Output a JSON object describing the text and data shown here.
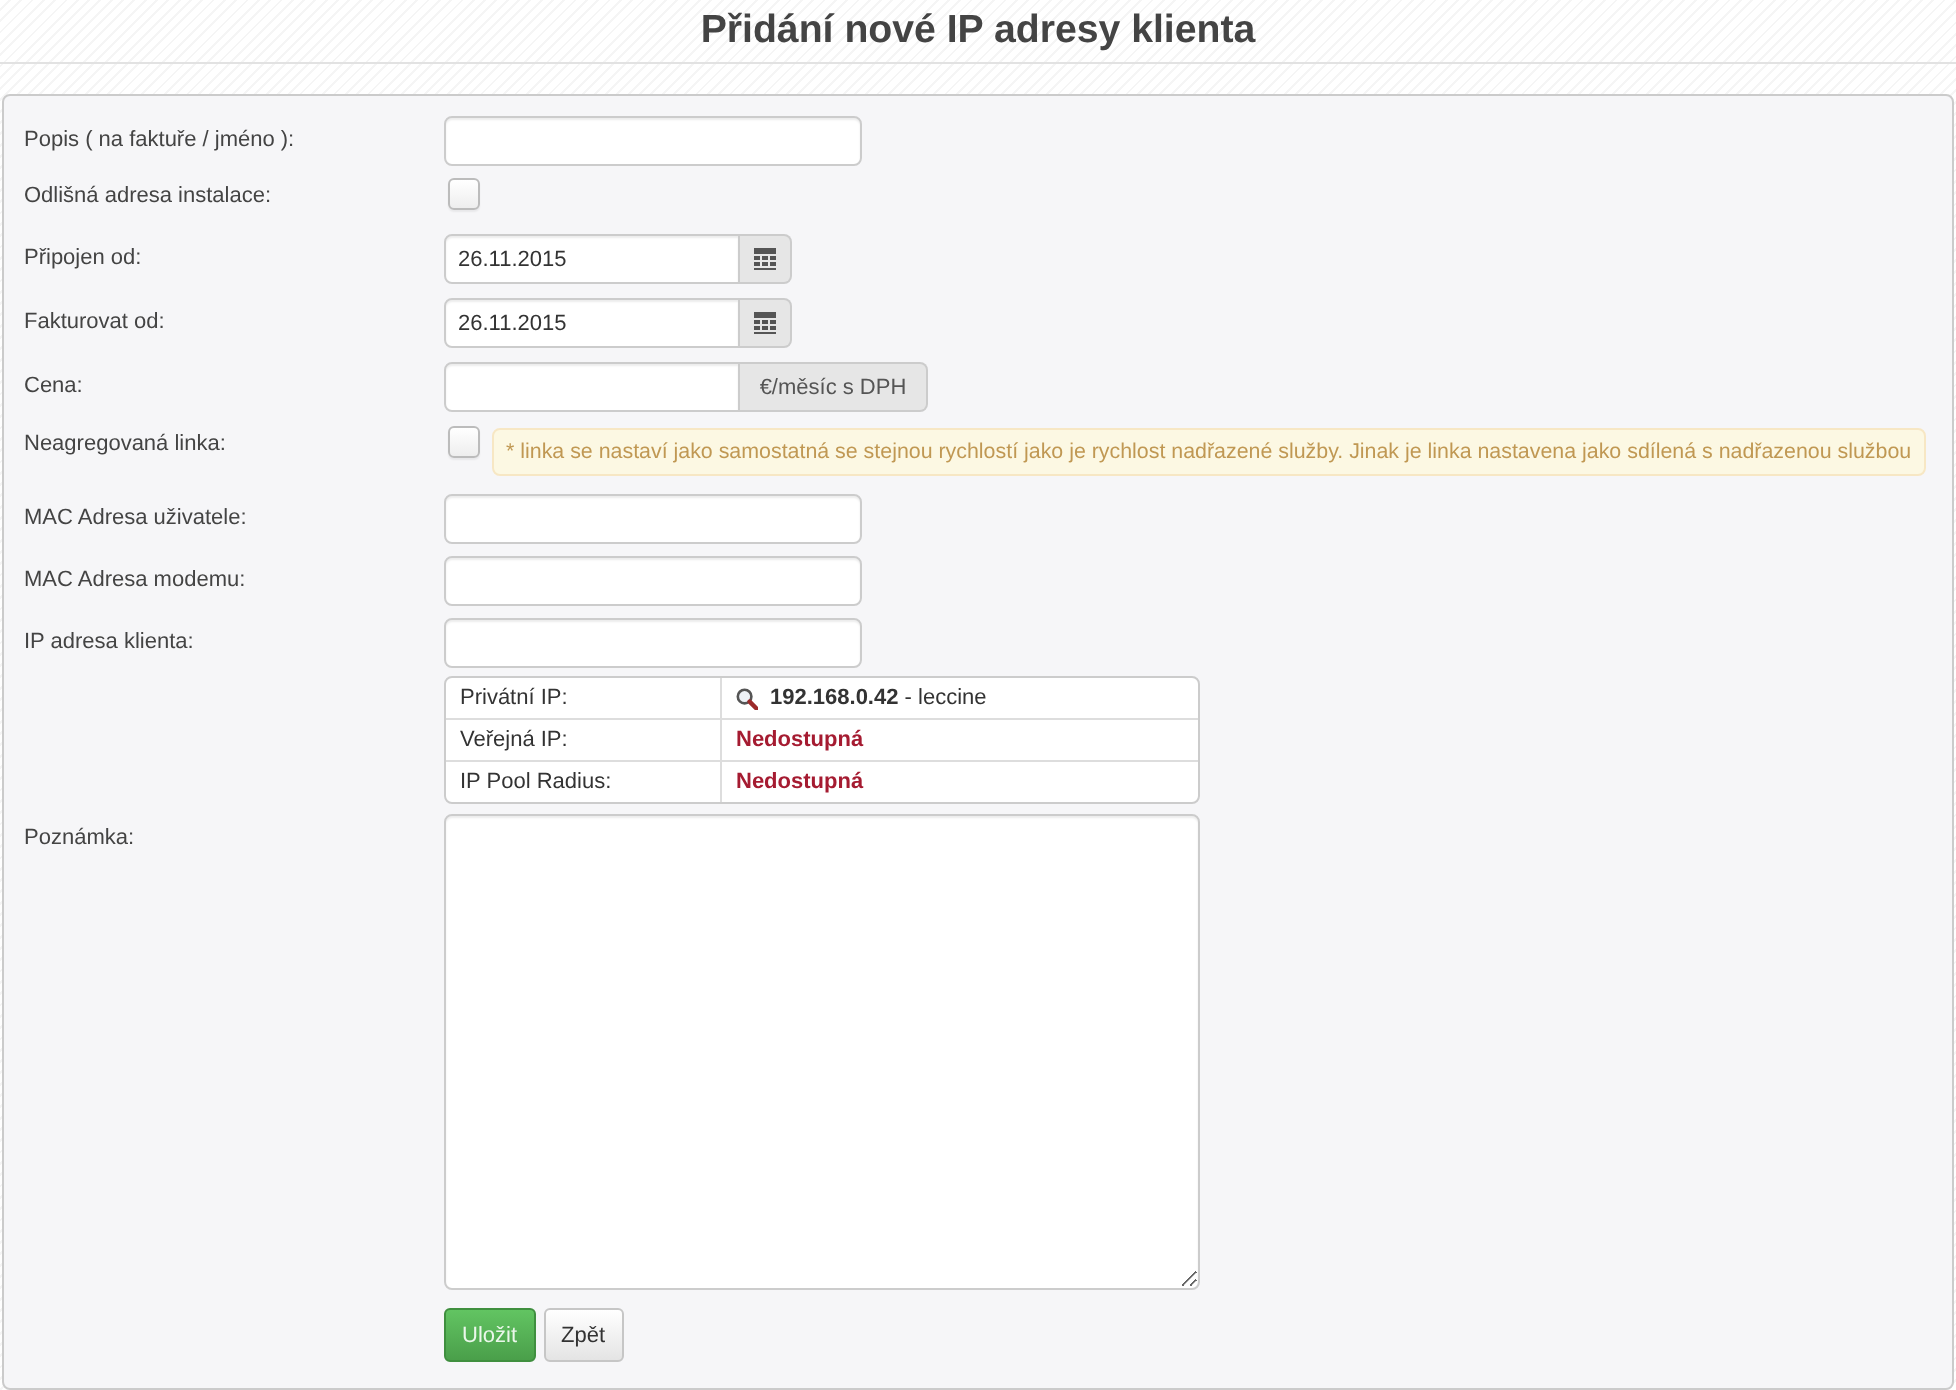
{
  "title": "Přidání nové IP adresy klienta",
  "form": {
    "fields": [
      {
        "kind": "text",
        "label": "Popis ( na faktuře / jméno ):"
      },
      {
        "kind": "checkbox",
        "label": "Odlišná adresa instalace:",
        "checked": false
      },
      {
        "kind": "date",
        "label": "Připojen od:",
        "value": "26.11.2015"
      },
      {
        "kind": "date",
        "label": "Fakturovat od:",
        "value": "26.11.2015"
      },
      {
        "kind": "addon",
        "label": "Cena:",
        "addon": "€/měsíc s DPH"
      },
      {
        "kind": "checkbox",
        "label": "Neagregovaná linka:",
        "checked": false,
        "note": "* linka se nastaví jako samostatná se stejnou rychlostí jako je rychlost nadřazené služby. Jinak je linka nastavena jako sdílená s nadřazenou službou"
      },
      {
        "kind": "text",
        "label": "MAC Adresa uživatele:"
      },
      {
        "kind": "text",
        "label": "MAC Adresa modemu:"
      },
      {
        "kind": "text",
        "label": "IP adresa klienta:",
        "info": [
          {
            "kind": "lookup",
            "label": "Privátní IP:",
            "value": "**192.168.0.42** - leccine"
          },
          {
            "kind": "status",
            "label": "Veřejná IP:",
            "value": "Nedostupná"
          },
          {
            "kind": "status",
            "label": "IP Pool Radius:",
            "value": "Nedostupná"
          }
        ]
      },
      {
        "kind": "textarea",
        "label": "Poznámka:"
      }
    ],
    "buttons": [
      {
        "kind": "primary",
        "label": "Uložit"
      },
      {
        "kind": "default",
        "label": "Zpět"
      }
    ]
  }
}
